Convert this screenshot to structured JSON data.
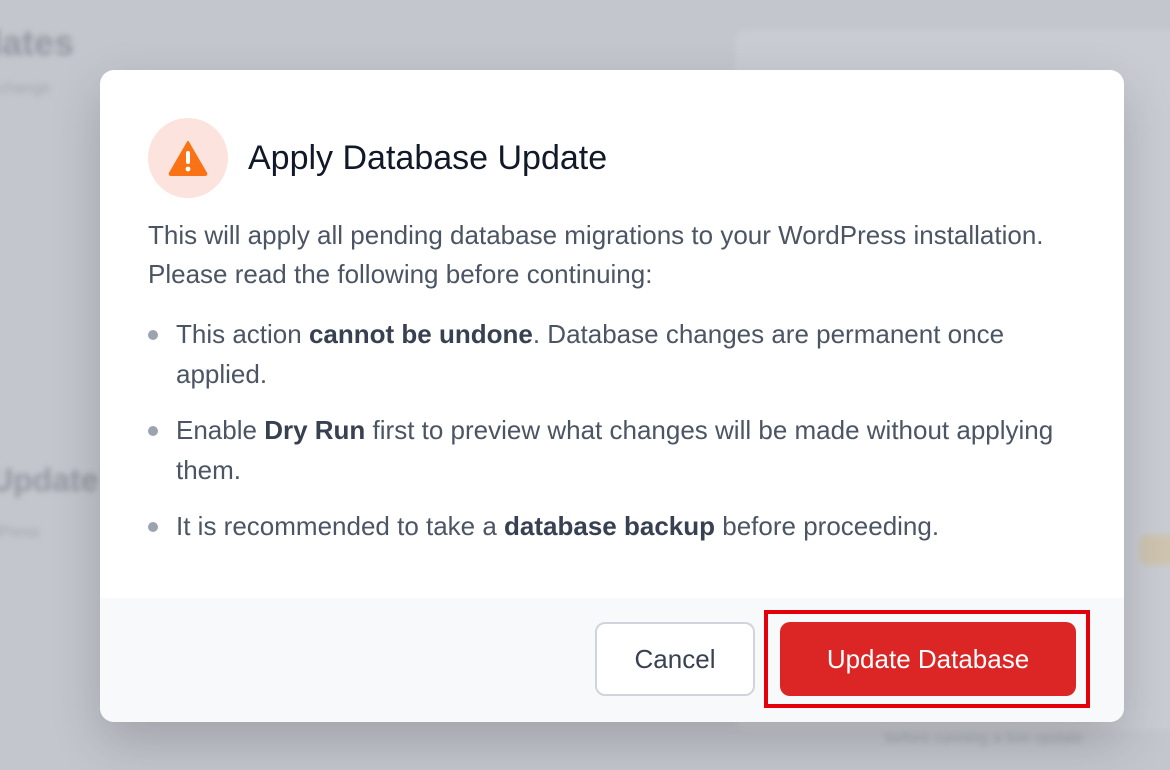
{
  "background": {
    "page_title": "dates",
    "page_subtitle": "l change",
    "section_title": "Update",
    "section_line": "dPress",
    "panel_footer": "before running a live update"
  },
  "dialog": {
    "icon": "warning-triangle-icon",
    "title": "Apply Database Update",
    "description": "This will apply all pending database migrations to your WordPress installation. Please read the following before continuing:",
    "bullets": [
      {
        "before": "This action ",
        "bold": "cannot be undone",
        "after": ". Database changes are permanent once applied."
      },
      {
        "before": "Enable ",
        "bold": "Dry Run",
        "after": " first to preview what changes will be made without applying them."
      },
      {
        "before": "It is recommended to take a ",
        "bold": "database backup",
        "after": " before proceeding."
      }
    ],
    "cancel_label": "Cancel",
    "confirm_label": "Update Database"
  },
  "colors": {
    "accent_danger": "#dc2626",
    "warning_icon": "#f97316",
    "warning_bg": "#fde3dd",
    "focus_ring": "#e3000b"
  }
}
